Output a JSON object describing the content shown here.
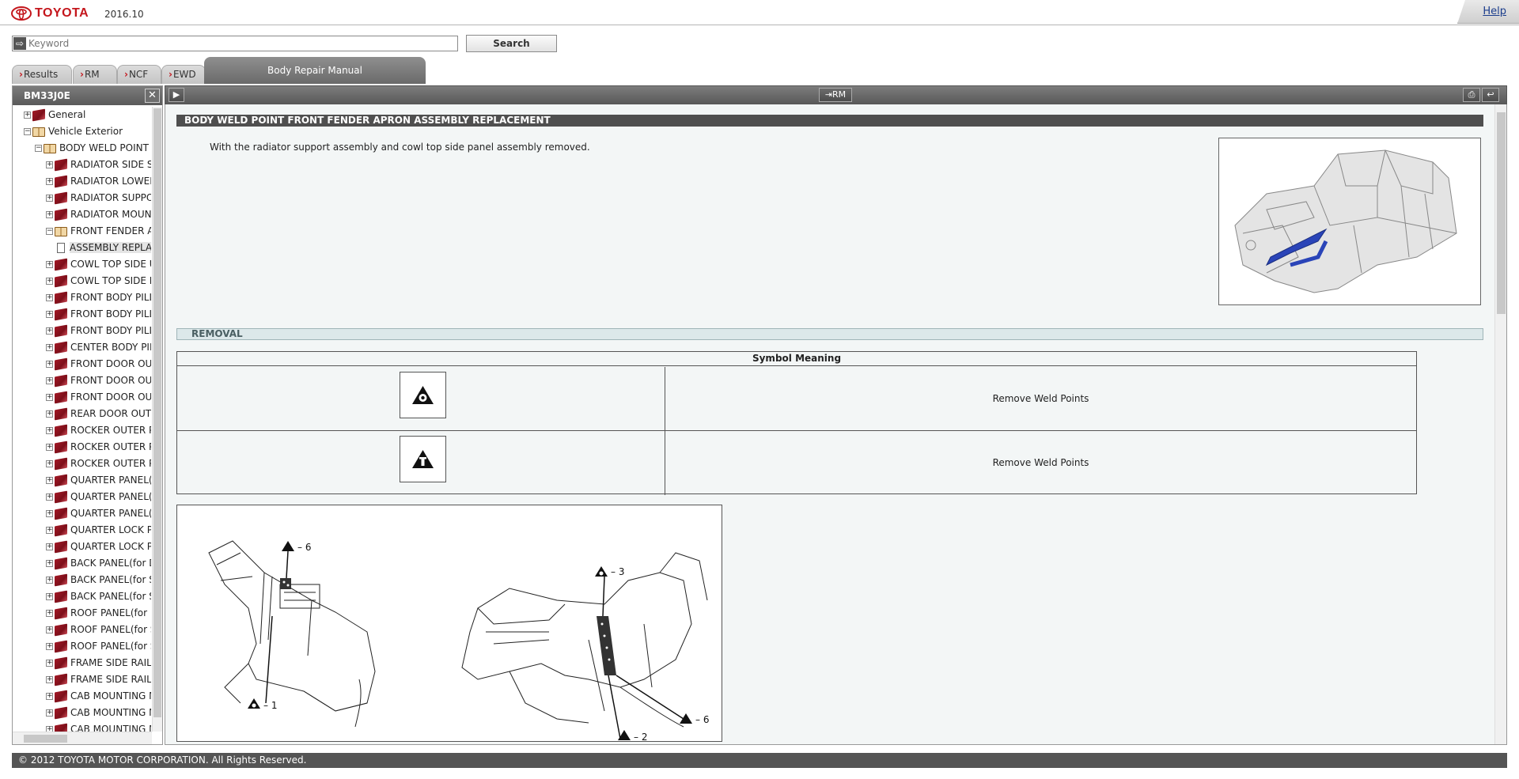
{
  "header": {
    "brand": "TOYOTA",
    "version": "2016.10",
    "help_label": "Help"
  },
  "search": {
    "placeholder": "Keyword",
    "button_label": "Search"
  },
  "tabs": [
    {
      "label": "Results"
    },
    {
      "label": "RM"
    },
    {
      "label": "NCF"
    },
    {
      "label": "EWD"
    }
  ],
  "active_tab": "Body Repair Manual",
  "left_panel": {
    "title": "BM33J0E",
    "tree": [
      {
        "label": "General",
        "expander": "+",
        "icon": "book",
        "level": 0
      },
      {
        "label": "Vehicle Exterior",
        "expander": "−",
        "icon": "book-open",
        "level": 0
      },
      {
        "label": "BODY WELD POINT",
        "expander": "−",
        "icon": "book-open",
        "level": 1
      },
      {
        "label": "RADIATOR SIDE S",
        "expander": "+",
        "icon": "book",
        "level": 2
      },
      {
        "label": "RADIATOR LOWER",
        "expander": "+",
        "icon": "book",
        "level": 2
      },
      {
        "label": "RADIATOR SUPPO",
        "expander": "+",
        "icon": "book",
        "level": 2
      },
      {
        "label": "RADIATOR MOUNT",
        "expander": "+",
        "icon": "book",
        "level": 2
      },
      {
        "label": "FRONT FENDER AI",
        "expander": "−",
        "icon": "book-open",
        "level": 2
      },
      {
        "label": "ASSEMBLY REPLAC",
        "expander": "",
        "icon": "doc",
        "level": 3,
        "selected": true
      },
      {
        "label": "COWL TOP SIDE U",
        "expander": "+",
        "icon": "book",
        "level": 2
      },
      {
        "label": "COWL TOP SIDE F",
        "expander": "+",
        "icon": "book",
        "level": 2
      },
      {
        "label": "FRONT BODY PILL",
        "expander": "+",
        "icon": "book",
        "level": 2
      },
      {
        "label": "FRONT BODY PILL",
        "expander": "+",
        "icon": "book",
        "level": 2
      },
      {
        "label": "FRONT BODY PILL",
        "expander": "+",
        "icon": "book",
        "level": 2
      },
      {
        "label": "CENTER BODY PIL",
        "expander": "+",
        "icon": "book",
        "level": 2
      },
      {
        "label": "FRONT DOOR OUT",
        "expander": "+",
        "icon": "book",
        "level": 2
      },
      {
        "label": "FRONT DOOR OUT",
        "expander": "+",
        "icon": "book",
        "level": 2
      },
      {
        "label": "FRONT DOOR OUT",
        "expander": "+",
        "icon": "book",
        "level": 2
      },
      {
        "label": "REAR DOOR OUTE",
        "expander": "+",
        "icon": "book",
        "level": 2
      },
      {
        "label": "ROCKER OUTER P",
        "expander": "+",
        "icon": "book",
        "level": 2
      },
      {
        "label": "ROCKER OUTER P",
        "expander": "+",
        "icon": "book",
        "level": 2
      },
      {
        "label": "ROCKER OUTER P",
        "expander": "+",
        "icon": "book",
        "level": 2
      },
      {
        "label": "QUARTER PANEL(I",
        "expander": "+",
        "icon": "book",
        "level": 2
      },
      {
        "label": "QUARTER PANEL(I",
        "expander": "+",
        "icon": "book",
        "level": 2
      },
      {
        "label": "QUARTER PANEL(I",
        "expander": "+",
        "icon": "book",
        "level": 2
      },
      {
        "label": "QUARTER LOCK P:",
        "expander": "+",
        "icon": "book",
        "level": 2
      },
      {
        "label": "QUARTER LOCK P:",
        "expander": "+",
        "icon": "book",
        "level": 2
      },
      {
        "label": "BACK PANEL(for D",
        "expander": "+",
        "icon": "book",
        "level": 2
      },
      {
        "label": "BACK PANEL(for S",
        "expander": "+",
        "icon": "book",
        "level": 2
      },
      {
        "label": "BACK PANEL(for S",
        "expander": "+",
        "icon": "book",
        "level": 2
      },
      {
        "label": "ROOF PANEL(for D",
        "expander": "+",
        "icon": "book",
        "level": 2
      },
      {
        "label": "ROOF PANEL(for S",
        "expander": "+",
        "icon": "book",
        "level": 2
      },
      {
        "label": "ROOF PANEL(for S",
        "expander": "+",
        "icon": "book",
        "level": 2
      },
      {
        "label": "FRAME SIDE RAIL",
        "expander": "+",
        "icon": "book",
        "level": 2
      },
      {
        "label": "FRAME SIDE RAIL",
        "expander": "+",
        "icon": "book",
        "level": 2
      },
      {
        "label": "CAB MOUNTING M",
        "expander": "+",
        "icon": "book",
        "level": 2
      },
      {
        "label": "CAB MOUNTING M",
        "expander": "+",
        "icon": "book",
        "level": 2
      },
      {
        "label": "CAB MOUNTING M",
        "expander": "+",
        "icon": "book",
        "level": 2
      }
    ]
  },
  "toolbar": {
    "rm_button": "RM"
  },
  "content": {
    "title": "BODY WELD POINT  FRONT FENDER APRON  ASSEMBLY REPLACEMENT",
    "intro": "With the radiator support assembly and cowl top side panel assembly removed.",
    "section": "REMOVAL",
    "symbol_table": {
      "header": "Symbol Meaning",
      "rows": [
        {
          "symbol": "circle-triangle-symbol",
          "meaning": "Remove Weld Points"
        },
        {
          "symbol": "bar-triangle-symbol",
          "meaning": "Remove Weld Points"
        }
      ]
    },
    "figure_callouts": [
      "6",
      "1",
      "3",
      "6",
      "2"
    ]
  },
  "footer": {
    "copyright": "© 2012 TOYOTA MOTOR CORPORATION. All Rights Reserved."
  },
  "colors": {
    "brand_red": "#c4161c",
    "titlebar_gray": "#5a5a5a",
    "content_bg": "#f3f6f6",
    "highlight_blue": "#2a44b8"
  }
}
